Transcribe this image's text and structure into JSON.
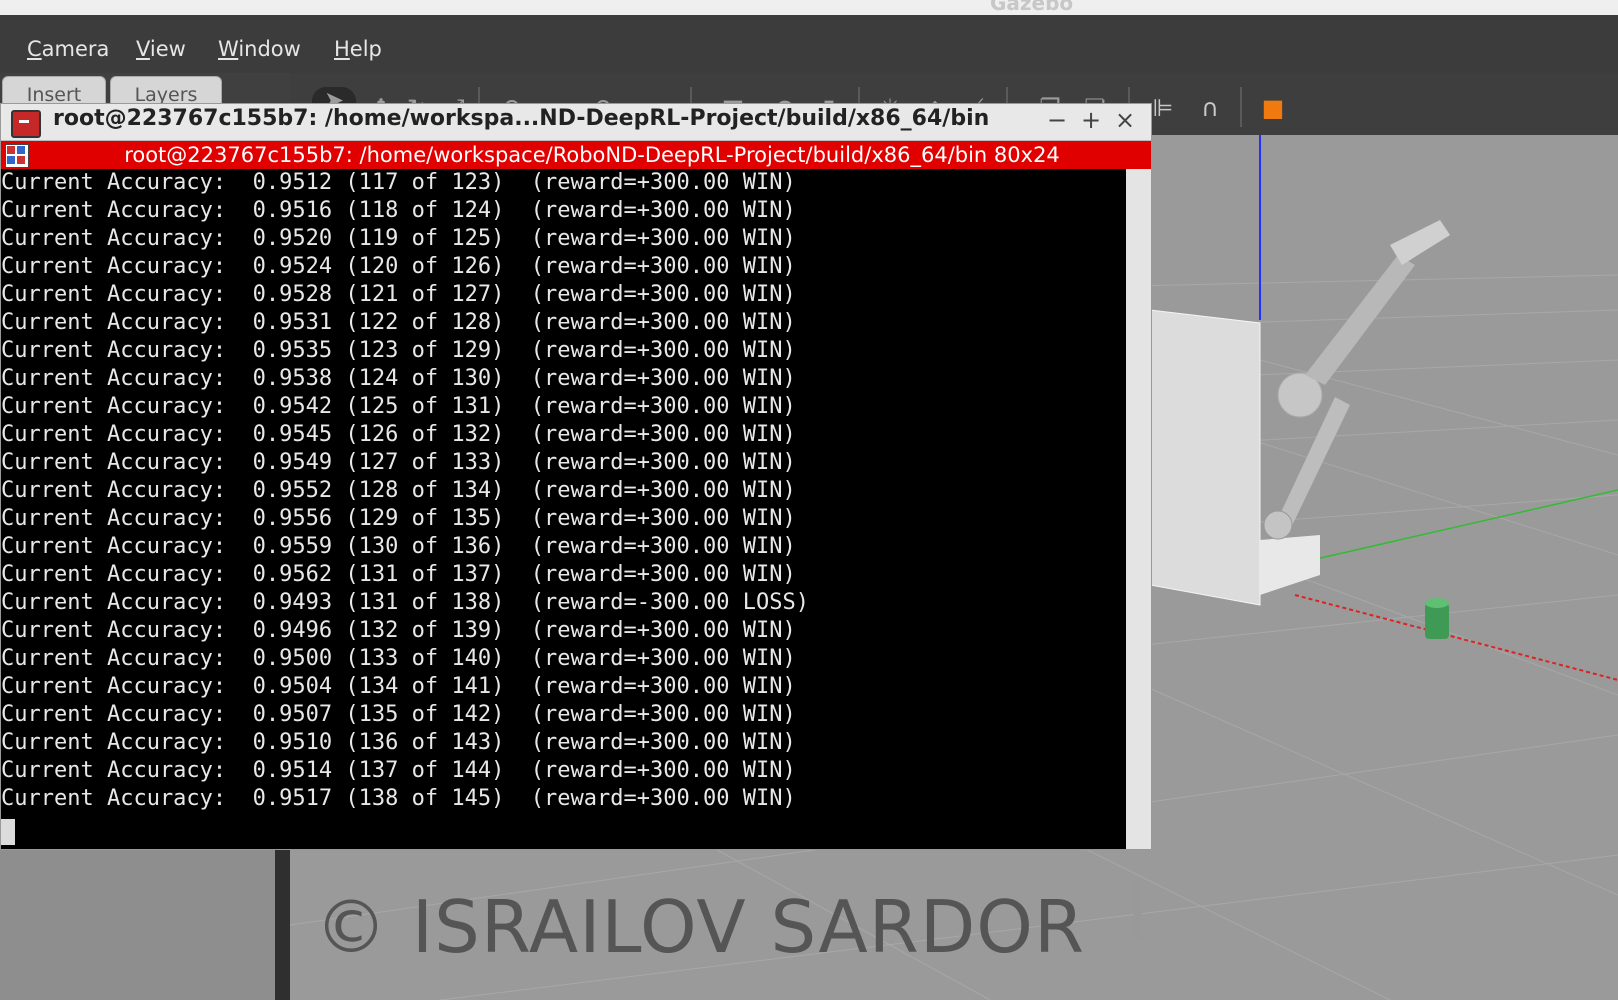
{
  "app": {
    "window_title": "Gazebo"
  },
  "menubar": {
    "items": [
      "Camera",
      "View",
      "Window",
      "Help"
    ]
  },
  "left_tabs": [
    "Insert",
    "Layers"
  ],
  "toolbar": {
    "icons": [
      "select-arrow-icon",
      "translate-icon",
      "rotate-icon",
      "scale-icon",
      "undo-icon",
      "redo-icon",
      "box-icon",
      "sphere-icon",
      "cylinder-icon",
      "sun-light-icon",
      "spot-light-icon",
      "directional-light-icon",
      "copy-icon",
      "paste-icon",
      "align-icon",
      "snap-magnet-icon",
      "orange-box-icon"
    ]
  },
  "terminal": {
    "outer_title": "root@223767c155b7: /home/workspa...ND-DeepRL-Project/build/x86_64/bin",
    "controls": [
      "−",
      "+",
      "×"
    ],
    "inner_title": "root@223767c155b7: /home/workspace/RoboND-DeepRL-Project/build/x86_64/bin 80x24",
    "lines": [
      "Current Accuracy:  0.9512 (117 of 123)  (reward=+300.00 WIN)",
      "Current Accuracy:  0.9516 (118 of 124)  (reward=+300.00 WIN)",
      "Current Accuracy:  0.9520 (119 of 125)  (reward=+300.00 WIN)",
      "Current Accuracy:  0.9524 (120 of 126)  (reward=+300.00 WIN)",
      "Current Accuracy:  0.9528 (121 of 127)  (reward=+300.00 WIN)",
      "Current Accuracy:  0.9531 (122 of 128)  (reward=+300.00 WIN)",
      "Current Accuracy:  0.9535 (123 of 129)  (reward=+300.00 WIN)",
      "Current Accuracy:  0.9538 (124 of 130)  (reward=+300.00 WIN)",
      "Current Accuracy:  0.9542 (125 of 131)  (reward=+300.00 WIN)",
      "Current Accuracy:  0.9545 (126 of 132)  (reward=+300.00 WIN)",
      "Current Accuracy:  0.9549 (127 of 133)  (reward=+300.00 WIN)",
      "Current Accuracy:  0.9552 (128 of 134)  (reward=+300.00 WIN)",
      "Current Accuracy:  0.9556 (129 of 135)  (reward=+300.00 WIN)",
      "Current Accuracy:  0.9559 (130 of 136)  (reward=+300.00 WIN)",
      "Current Accuracy:  0.9562 (131 of 137)  (reward=+300.00 WIN)",
      "Current Accuracy:  0.9493 (131 of 138)  (reward=-300.00 LOSS)",
      "Current Accuracy:  0.9496 (132 of 139)  (reward=+300.00 WIN)",
      "Current Accuracy:  0.9500 (133 of 140)  (reward=+300.00 WIN)",
      "Current Accuracy:  0.9504 (134 of 141)  (reward=+300.00 WIN)",
      "Current Accuracy:  0.9507 (135 of 142)  (reward=+300.00 WIN)",
      "Current Accuracy:  0.9510 (136 of 143)  (reward=+300.00 WIN)",
      "Current Accuracy:  0.9514 (137 of 144)  (reward=+300.00 WIN)",
      "Current Accuracy:  0.9517 (138 of 145)  (reward=+300.00 WIN)"
    ]
  },
  "watermark": "© ISRAILOV SARDOR",
  "colors": {
    "terminal_red": "#e00000",
    "terminal_bg": "#000000",
    "menubar_bg": "#3c3c3c"
  }
}
